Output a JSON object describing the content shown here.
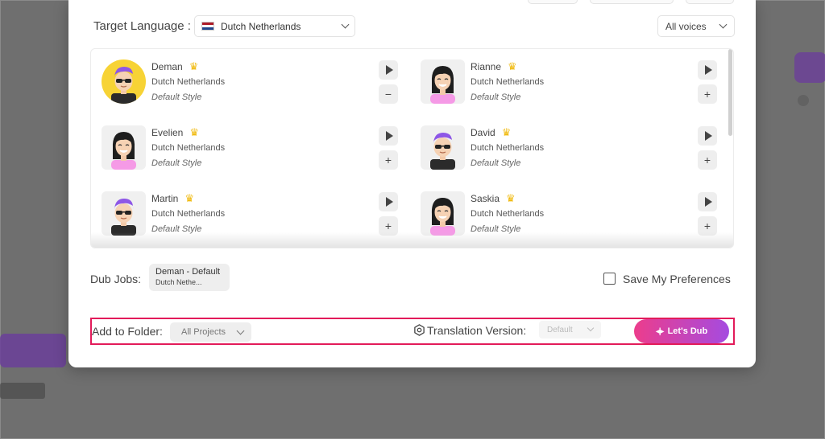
{
  "header": {
    "target_language_label": "Target Language",
    "separator": ":",
    "language_selected": "Dutch Netherlands",
    "voices_filter": "All voices"
  },
  "voices": [
    {
      "name": "Deman",
      "language": "Dutch Netherlands",
      "style": "Default Style",
      "premium": true,
      "action": "remove",
      "action_icon": "−"
    },
    {
      "name": "Rianne",
      "language": "Dutch Netherlands",
      "style": "Default Style",
      "premium": true,
      "action": "add",
      "action_icon": "+"
    },
    {
      "name": "Evelien",
      "language": "Dutch Netherlands",
      "style": "Default Style",
      "premium": true,
      "action": "add",
      "action_icon": "+"
    },
    {
      "name": "David",
      "language": "Dutch Netherlands",
      "style": "Default Style",
      "premium": true,
      "action": "add",
      "action_icon": "+"
    },
    {
      "name": "Martin",
      "language": "Dutch Netherlands",
      "style": "Default Style",
      "premium": true,
      "action": "add",
      "action_icon": "+"
    },
    {
      "name": "Saskia",
      "language": "Dutch Netherlands",
      "style": "Default Style",
      "premium": true,
      "action": "add",
      "action_icon": "+"
    }
  ],
  "crown_icon": "♛",
  "dub_jobs": {
    "label": "Dub Jobs:",
    "chip_title": "Deman - Default",
    "chip_subtitle": "Dutch Nethe..."
  },
  "preferences": {
    "label": "Save My Preferences",
    "checked": false
  },
  "footer": {
    "folder_label": "Add to Folder:",
    "folder_value": "All Projects",
    "translation_label": "Translation Version:",
    "translation_value": "Default",
    "dub_button": "Let's Dub",
    "dub_button_icon": "◂|▸"
  },
  "colors": {
    "accent_start": "#ec3d8c",
    "accent_end": "#a54be0",
    "highlight_border": "#e21b5a",
    "crown": "#f0b90b"
  }
}
